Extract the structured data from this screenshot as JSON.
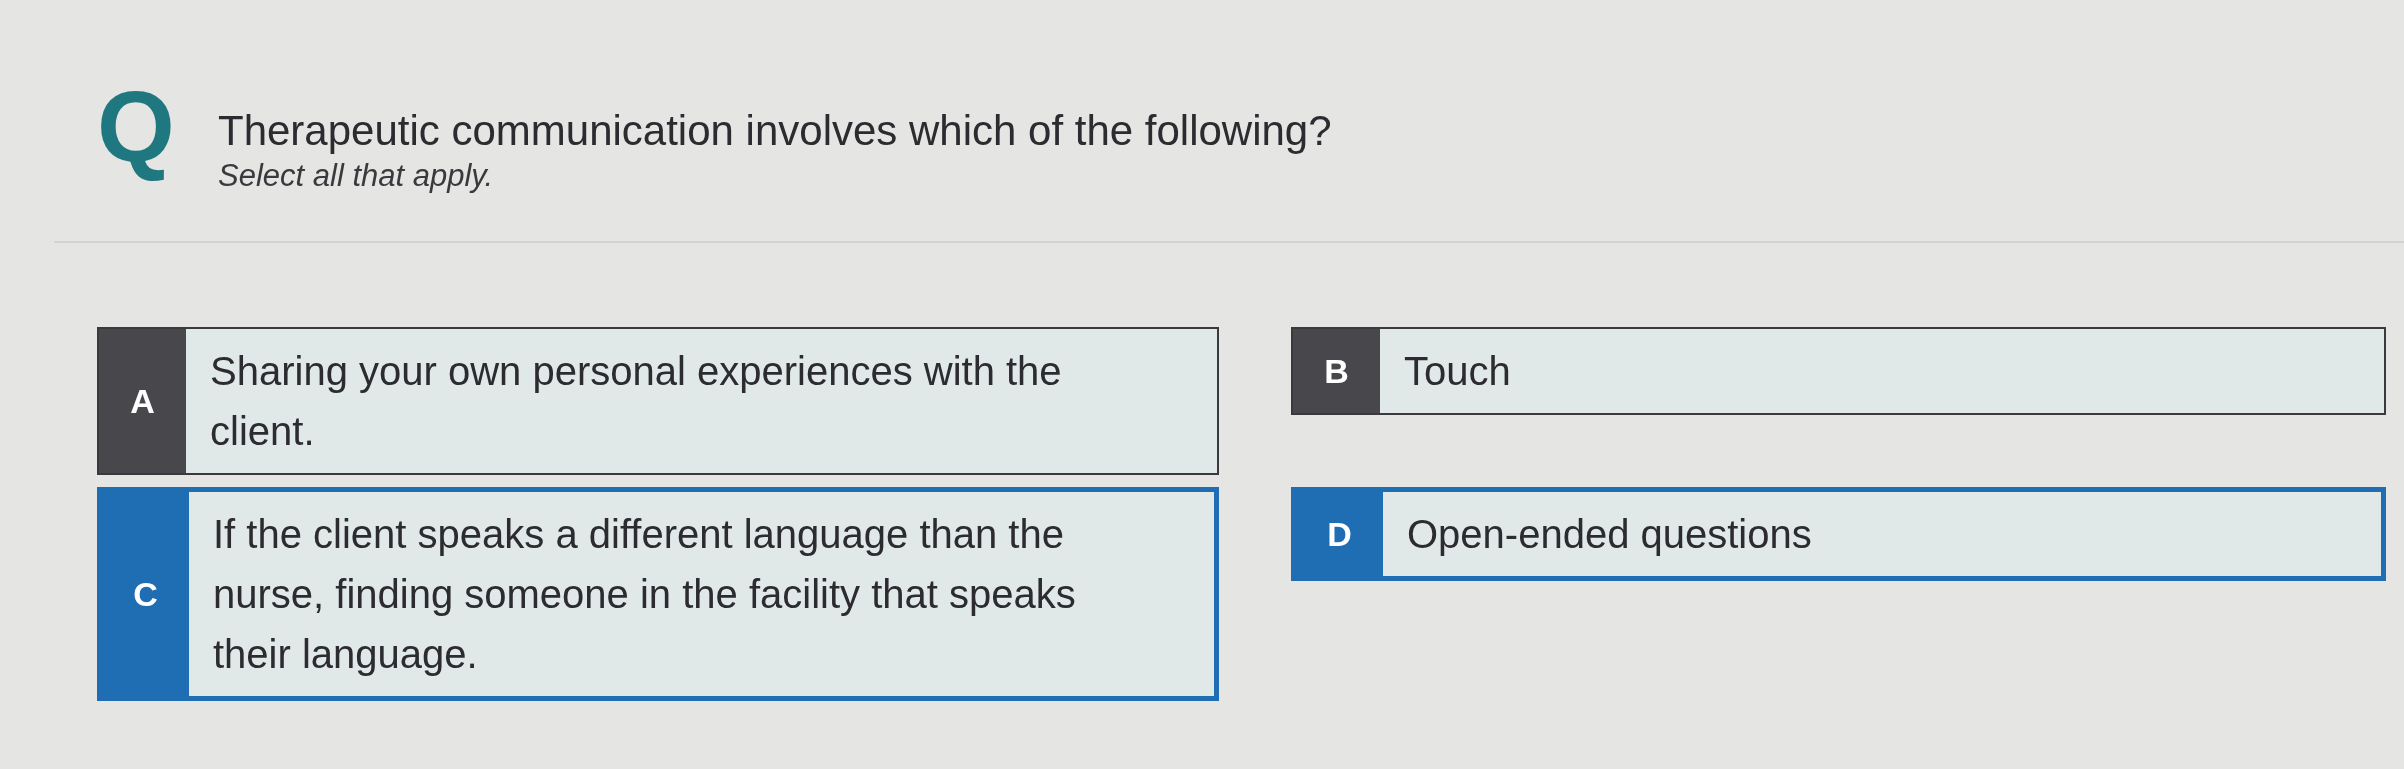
{
  "question": {
    "badge": "Q",
    "text": "Therapeutic communication involves which of the following?",
    "instruction": "Select all that apply."
  },
  "options": [
    {
      "letter": "A",
      "text": "Sharing your own personal experiences with the client.",
      "selected": false
    },
    {
      "letter": "B",
      "text": "Touch",
      "selected": false
    },
    {
      "letter": "C",
      "text": "If the client speaks a different language than the nurse, finding someone in the facility that speaks their language.",
      "selected": true
    },
    {
      "letter": "D",
      "text": "Open-ended questions",
      "selected": true
    }
  ]
}
